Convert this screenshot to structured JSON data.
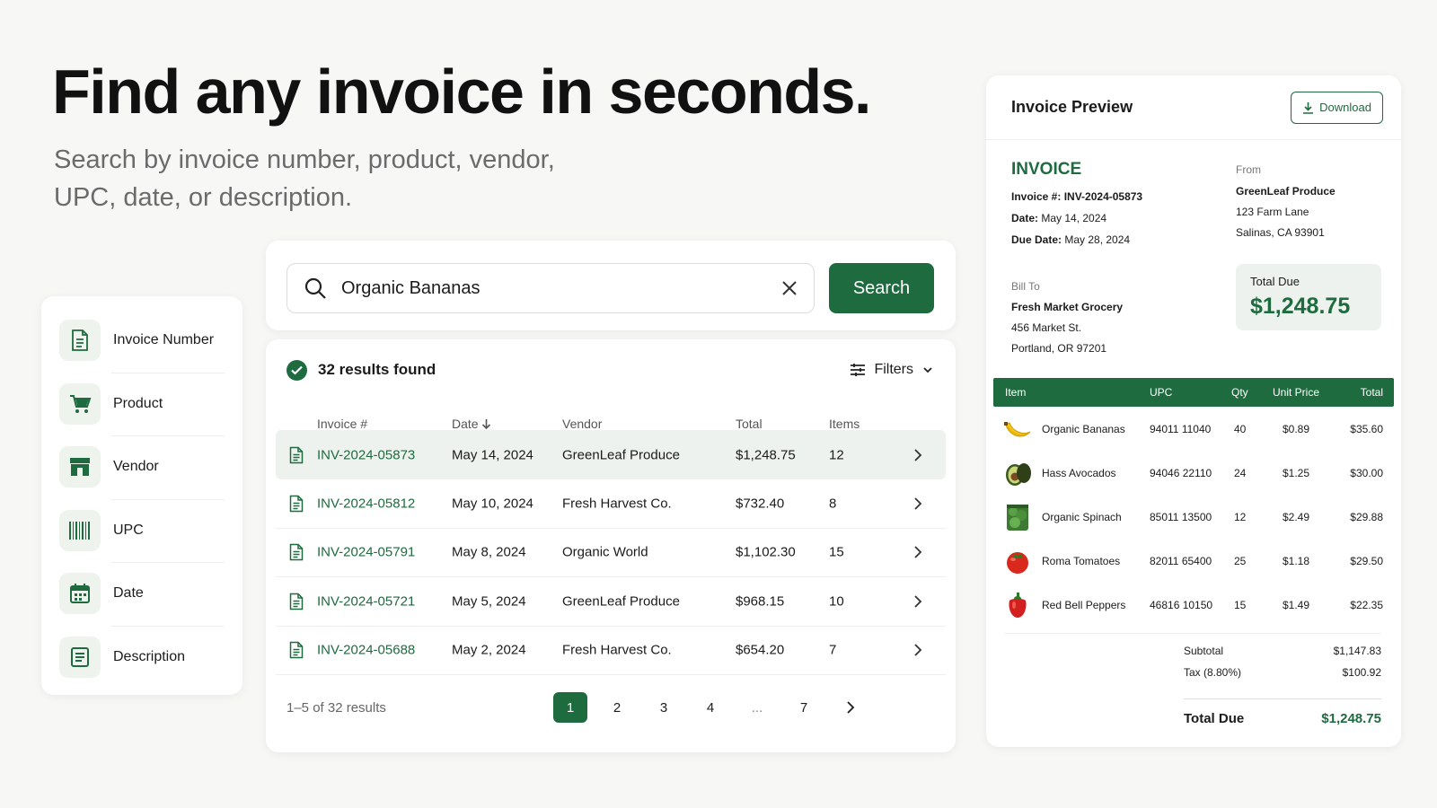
{
  "hero": {
    "title": "Find any invoice in seconds.",
    "subtitle": "Search by invoice number, product, vendor, UPC, date, or description."
  },
  "sidebar": {
    "items": [
      {
        "label": "Invoice Number",
        "icon": "document-icon"
      },
      {
        "label": "Product",
        "icon": "cart-icon"
      },
      {
        "label": "Vendor",
        "icon": "store-icon"
      },
      {
        "label": "UPC",
        "icon": "barcode-icon"
      },
      {
        "label": "Date",
        "icon": "calendar-icon"
      },
      {
        "label": "Description",
        "icon": "text-lines-icon"
      }
    ]
  },
  "search": {
    "value": "Organic Bananas",
    "button_label": "Search"
  },
  "results": {
    "count_text": "32 results found",
    "filters_label": "Filters",
    "columns": {
      "invoice": "Invoice #",
      "date": "Date",
      "vendor": "Vendor",
      "total": "Total",
      "items": "Items"
    },
    "rows": [
      {
        "invoice": "INV-2024-05873",
        "date": "May 14, 2024",
        "vendor": "GreenLeaf Produce",
        "total": "$1,248.75",
        "items": "12"
      },
      {
        "invoice": "INV-2024-05812",
        "date": "May 10, 2024",
        "vendor": "Fresh Harvest Co.",
        "total": "$732.40",
        "items": "8"
      },
      {
        "invoice": "INV-2024-05791",
        "date": "May 8, 2024",
        "vendor": "Organic World",
        "total": "$1,102.30",
        "items": "15"
      },
      {
        "invoice": "INV-2024-05721",
        "date": "May 5, 2024",
        "vendor": "GreenLeaf Produce",
        "total": "$968.15",
        "items": "10"
      },
      {
        "invoice": "INV-2024-05688",
        "date": "May 2, 2024",
        "vendor": "Fresh Harvest Co.",
        "total": "$654.20",
        "items": "7"
      }
    ],
    "pager": {
      "info": "1–5 of 32 results",
      "pages": [
        "1",
        "2",
        "3",
        "4",
        "...",
        "7"
      ],
      "active": "1"
    }
  },
  "preview": {
    "title": "Invoice Preview",
    "download_label": "Download",
    "heading": "INVOICE",
    "invoice_no_label": "Invoice #:",
    "invoice_no": "INV-2024-05873",
    "date_label": "Date:",
    "date": "May 14, 2024",
    "due_label": "Due Date:",
    "due_date": "May 28, 2024",
    "from_label": "From",
    "from_lines": [
      "GreenLeaf Produce",
      "123 Farm Lane",
      "Salinas, CA 93901"
    ],
    "bill_to_label": "Bill To",
    "bill_to_lines": [
      "Fresh Market Grocery",
      "456 Market St.",
      "Portland, OR 97201"
    ],
    "total_due_label": "Total Due",
    "total_due": "$1,248.75",
    "item_columns": {
      "item": "Item",
      "upc": "UPC",
      "qty": "Qty",
      "unit": "Unit Price",
      "total": "Total"
    },
    "items": [
      {
        "name": "Organic Bananas",
        "upc": "94011 11040",
        "qty": "40",
        "unit": "$0.89",
        "total": "$35.60",
        "icon": "banana-icon"
      },
      {
        "name": "Hass Avocados",
        "upc": "94046 22110",
        "qty": "24",
        "unit": "$1.25",
        "total": "$30.00",
        "icon": "avocado-icon"
      },
      {
        "name": "Organic Spinach",
        "upc": "85011 13500",
        "qty": "12",
        "unit": "$2.49",
        "total": "$29.88",
        "icon": "spinach-icon"
      },
      {
        "name": "Roma Tomatoes",
        "upc": "82011 65400",
        "qty": "25",
        "unit": "$1.18",
        "total": "$29.50",
        "icon": "tomato-icon"
      },
      {
        "name": "Red Bell Peppers",
        "upc": "46816 10150",
        "qty": "15",
        "unit": "$1.49",
        "total": "$22.35",
        "icon": "pepper-icon"
      }
    ],
    "subtotal_label": "Subtotal",
    "subtotal": "$1,147.83",
    "tax_label": "Tax (8.80%)",
    "tax": "$100.92",
    "grand_label": "Total Due",
    "grand_total": "$1,248.75"
  },
  "colors": {
    "accent": "#1e6b3f",
    "selected_row": "#eef2ee",
    "background": "#f7f7f5"
  }
}
